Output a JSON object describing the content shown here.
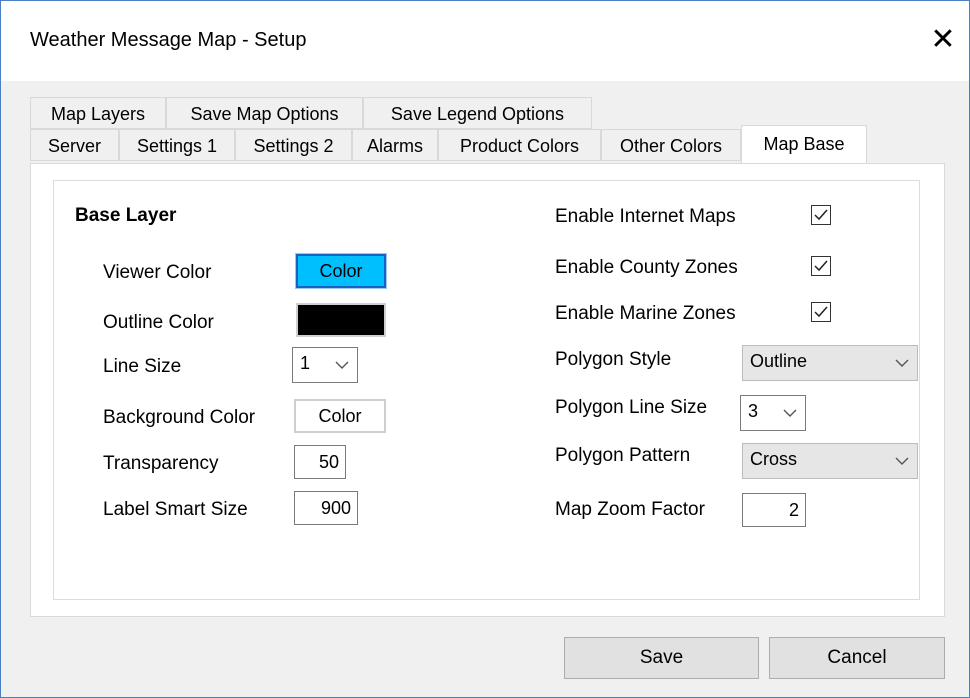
{
  "window": {
    "title": "Weather Message Map - Setup",
    "close_glyph": "✕"
  },
  "tabs": {
    "row1": [
      "Map Layers",
      "Save Map Options",
      "Save Legend Options"
    ],
    "row2": [
      "Server",
      "Settings 1",
      "Settings 2",
      "Alarms",
      "Product Colors",
      "Other Colors"
    ],
    "active": "Map Base"
  },
  "base_layer": {
    "heading": "Base Layer",
    "viewer_color_label": "Viewer Color",
    "viewer_color_button": "Color",
    "outline_color_label": "Outline Color",
    "line_size_label": "Line Size",
    "line_size_value": "1",
    "background_color_label": "Background Color",
    "background_color_button": "Color",
    "transparency_label": "Transparency",
    "transparency_value": "50",
    "label_smart_size_label": "Label Smart Size",
    "label_smart_size_value": "900"
  },
  "options": {
    "enable_internet_maps_label": "Enable Internet Maps",
    "enable_internet_maps_checked": true,
    "enable_county_zones_label": "Enable County Zones",
    "enable_county_zones_checked": true,
    "enable_marine_zones_label": "Enable Marine Zones",
    "enable_marine_zones_checked": true,
    "polygon_style_label": "Polygon Style",
    "polygon_style_value": "Outline",
    "polygon_line_size_label": "Polygon Line Size",
    "polygon_line_size_value": "3",
    "polygon_pattern_label": "Polygon Pattern",
    "polygon_pattern_value": "Cross",
    "map_zoom_factor_label": "Map Zoom Factor",
    "map_zoom_factor_value": "2"
  },
  "footer": {
    "save_label": "Save",
    "cancel_label": "Cancel"
  },
  "colors": {
    "viewer_color": "#00bfff",
    "outline_color": "#000000",
    "window_border": "#4a7fc4"
  },
  "icons": {
    "close": "close-icon",
    "dropdown": "chevron-down-icon",
    "check": "checkmark-icon"
  }
}
